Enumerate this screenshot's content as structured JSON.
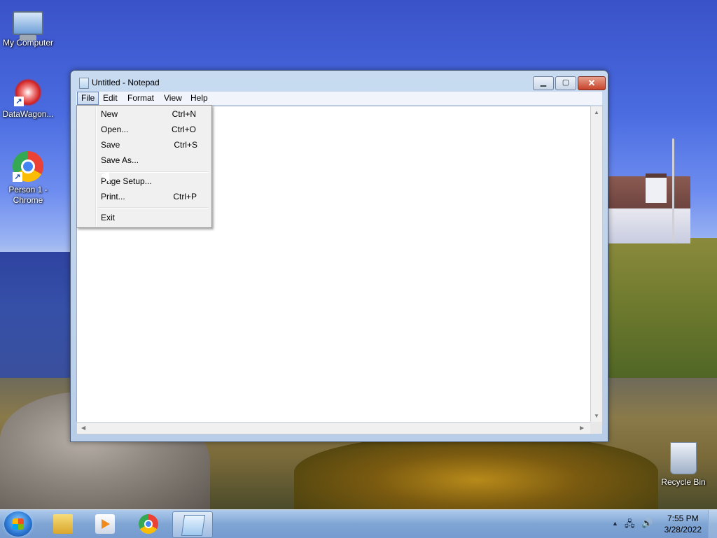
{
  "desktop": {
    "icons": [
      {
        "label": "My Computer",
        "icon": "computer-icon"
      },
      {
        "label": "DataWagon...",
        "icon": "datawagon-icon"
      },
      {
        "label": "Person 1 - Chrome",
        "icon": "chrome-icon"
      },
      {
        "label": "Recycle Bin",
        "icon": "recycle-bin-icon"
      }
    ]
  },
  "window": {
    "title": "Untitled - Notepad",
    "controls": {
      "minimize": "▁",
      "maximize": "▢",
      "close": "✕"
    },
    "menu": [
      "File",
      "Edit",
      "Format",
      "View",
      "Help"
    ],
    "active_menu": "File"
  },
  "file_menu": {
    "items": [
      {
        "label": "New",
        "shortcut": "Ctrl+N"
      },
      {
        "label": "Open...",
        "shortcut": "Ctrl+O"
      },
      {
        "label": "Save",
        "shortcut": "Ctrl+S"
      },
      {
        "label": "Save As...",
        "shortcut": ""
      },
      {
        "label": "Page Setup...",
        "shortcut": ""
      },
      {
        "label": "Print...",
        "shortcut": "Ctrl+P"
      },
      {
        "label": "Exit",
        "shortcut": ""
      }
    ]
  },
  "taskbar": {
    "apps": [
      "windows-explorer-icon",
      "media-player-icon",
      "chrome-icon",
      "notepad-icon"
    ],
    "active_app": "notepad-icon",
    "clock": {
      "time": "7:55 PM",
      "date": "3/28/2022"
    },
    "tray": {
      "up_arrow": "▲",
      "network": "🖧",
      "volume": "🔊"
    }
  }
}
